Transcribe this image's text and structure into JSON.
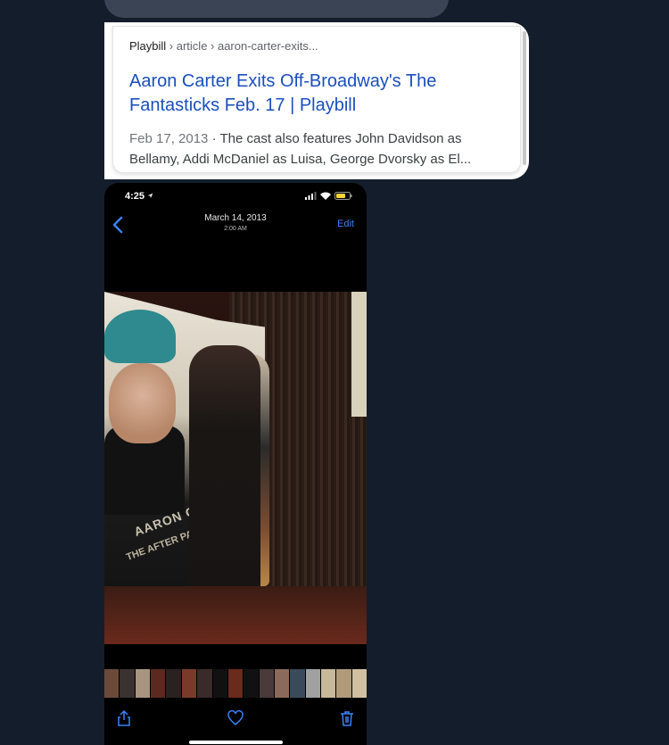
{
  "search_result": {
    "site": "Playbill",
    "breadcrumb_rest": " › article › aaron-carter-exits...",
    "title": "Aaron Carter Exits Off-Broadway's The Fantasticks Feb. 17 | Playbill",
    "date": "Feb 17, 2013",
    "snippet": " · The cast also features John Davidson as Bellamy, Addi McDaniel as Luisa, George Dvorsky as El..."
  },
  "phone": {
    "status_time": "4:25",
    "photo_date": "March 14, 2013",
    "photo_time": "2:00 AM",
    "edit_label": "Edit",
    "banner_text": "AARON CARTER",
    "banner_sub": "THE AFTER PARTY",
    "icons": [
      "location-arrow-icon",
      "signal-icon",
      "wifi-icon",
      "battery-icon",
      "back-chevron-icon",
      "share-icon",
      "heart-icon",
      "trash-icon"
    ],
    "accent": "#3a82f7"
  }
}
